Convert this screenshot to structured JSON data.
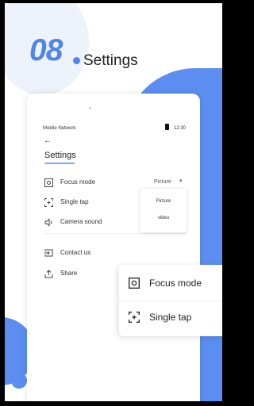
{
  "header": {
    "number": "08",
    "title": "Settings"
  },
  "phone": {
    "status": {
      "carrier": "Mobile Network",
      "time": "12:30"
    },
    "title": "Settings",
    "items": [
      {
        "label": "Focus mode",
        "value": "Picture"
      },
      {
        "label": "Single tap"
      },
      {
        "label": "Camera sound"
      },
      {
        "label": "Contact us"
      },
      {
        "label": "Share"
      }
    ],
    "dropdown": {
      "options": [
        "Picture",
        "video"
      ]
    }
  },
  "zoom": {
    "items": [
      {
        "label": "Focus mode"
      },
      {
        "label": "Single tap"
      }
    ]
  },
  "colors": {
    "accent": "#5b8ef0",
    "text": "#222222",
    "background": "#ffffff"
  }
}
